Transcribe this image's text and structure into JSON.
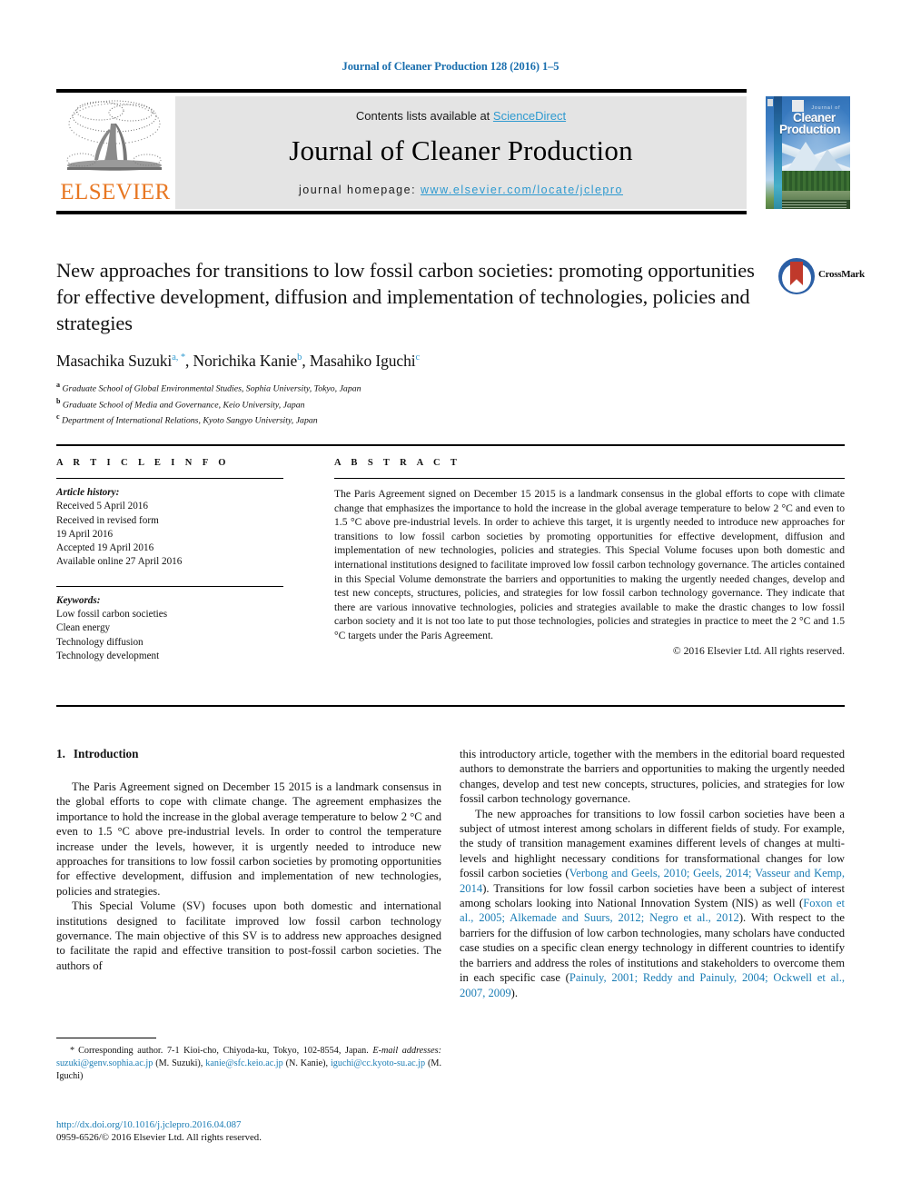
{
  "running_head": "Journal of Cleaner Production 128 (2016) 1–5",
  "masthead": {
    "contents_prefix": "Contents lists available at ",
    "sciencedirect": "ScienceDirect",
    "journal_title": "Journal of Cleaner Production",
    "homepage_prefix": "journal homepage: ",
    "homepage_url": "www.elsevier.com/locate/jclepro",
    "publisher": "ELSEVIER",
    "accent_blue": "#2e9ad0",
    "panel_grey": "#e4e4e4",
    "elsevier_orange": "#E87722"
  },
  "cover": {
    "line_journal_of": "Journal of",
    "line1": "Cleaner",
    "line2": "Production"
  },
  "crossmark": {
    "label": "CrossMark"
  },
  "article": {
    "title": "New approaches for transitions to low fossil carbon societies: promoting opportunities for effective development, diffusion and implementation of technologies, policies and strategies",
    "authors": [
      {
        "name": "Masachika Suzuki",
        "marks": "a, *"
      },
      {
        "name": "Norichika Kanie",
        "marks": "b"
      },
      {
        "name": "Masahiko Iguchi",
        "marks": "c"
      }
    ],
    "affiliations": [
      {
        "mark": "a",
        "text": "Graduate School of Global Environmental Studies, Sophia University, Tokyo, Japan"
      },
      {
        "mark": "b",
        "text": "Graduate School of Media and Governance, Keio University, Japan"
      },
      {
        "mark": "c",
        "text": "Department of International Relations, Kyoto Sangyo University, Japan"
      }
    ]
  },
  "info": {
    "heading": "A R T I C L E   I N F O",
    "history_label": "Article history:",
    "history": [
      "Received 5 April 2016",
      "Received in revised form",
      "19 April 2016",
      "Accepted 19 April 2016",
      "Available online 27 April 2016"
    ],
    "keywords_label": "Keywords:",
    "keywords": [
      "Low fossil carbon societies",
      "Clean energy",
      "Technology diffusion",
      "Technology development"
    ]
  },
  "abstract": {
    "heading": "A B S T R A C T",
    "text": "The Paris Agreement signed on December 15 2015 is a landmark consensus in the global efforts to cope with climate change that emphasizes the importance to hold the increase in the global average temperature to below 2 °C and even to 1.5 °C above pre-industrial levels. In order to achieve this target, it is urgently needed to introduce new approaches for transitions to low fossil carbon societies by promoting opportunities for effective development, diffusion and implementation of new technologies, policies and strategies. This Special Volume focuses upon both domestic and international institutions designed to facilitate improved low fossil carbon technology governance. The articles contained in this Special Volume demonstrate the barriers and opportunities to making the urgently needed changes, develop and test new concepts, structures, policies, and strategies for low fossil carbon technology governance. They indicate that there are various innovative technologies, policies and strategies available to make the drastic changes to low fossil carbon society and it is not too late to put those technologies, policies and strategies in practice to meet the 2 °C and 1.5 °C targets under the Paris Agreement.",
    "copyright": "© 2016 Elsevier Ltd. All rights reserved."
  },
  "body": {
    "section_number": "1.",
    "section_title": "Introduction",
    "left_paragraphs": [
      "The Paris Agreement signed on December 15 2015 is a landmark consensus in the global efforts to cope with climate change. The agreement emphasizes the importance to hold the increase in the global average temperature to below 2 °C and even to 1.5 °C above pre-industrial levels. In order to control the temperature increase under the levels, however, it is urgently needed to introduce new approaches for transitions to low fossil carbon societies by promoting opportunities for effective development, diffusion and implementation of new technologies, policies and strategies.",
      "This Special Volume (SV) focuses upon both domestic and international institutions designed to facilitate improved low fossil carbon technology governance. The main objective of this SV is to address new approaches designed to facilitate the rapid and effective transition to post-fossil carbon societies. The authors of"
    ],
    "right_paragraph_1": "this introductory article, together with the members in the editorial board requested authors to demonstrate the barriers and opportunities to making the urgently needed changes, develop and test new concepts, structures, policies, and strategies for low fossil carbon technology governance.",
    "right_paragraph_2_a": "The new approaches for transitions to low fossil carbon societies have been a subject of utmost interest among scholars in different fields of study. For example, the study of transition management examines different levels of changes at multi-levels and highlight necessary conditions for transformational changes for low fossil carbon societies (",
    "right_ref_1": "Verbong and Geels, 2010; Geels, 2014; Vasseur and Kemp, 2014",
    "right_paragraph_2_b": "). Transitions for low fossil carbon societies have been a subject of interest among scholars looking into National Innovation System (NIS) as well (",
    "right_ref_2": "Foxon et al., 2005; Alkemade and Suurs, 2012; Negro et al., 2012",
    "right_paragraph_2_c": "). With respect to the barriers for the diffusion of low carbon technologies, many scholars have conducted case studies on a specific clean energy technology in different countries to identify the barriers and address the roles of institutions and stakeholders to overcome them in each specific case (",
    "right_ref_3": "Painuly, 2001; Reddy and Painuly, 2004; Ockwell et al., 2007, 2009",
    "right_paragraph_2_d": ")."
  },
  "footnote": {
    "star": "*",
    "corresponding": "Corresponding author. 7-1 Kioi-cho, Chiyoda-ku, Tokyo, 102-8554, Japan.",
    "email_label": "E-mail addresses:",
    "emails": [
      {
        "addr": "suzuki@genv.sophia.ac.jp",
        "who": "(M. Suzuki)"
      },
      {
        "addr": "kanie@sfc.keio.ac.jp",
        "who": "(N. Kanie)"
      },
      {
        "addr": "iguchi@cc.kyoto-su.ac.jp",
        "who": "(M. Iguchi)"
      }
    ]
  },
  "publication": {
    "doi": "http://dx.doi.org/10.1016/j.jclepro.2016.04.087",
    "issn_line": "0959-6526/© 2016 Elsevier Ltd. All rights reserved."
  }
}
